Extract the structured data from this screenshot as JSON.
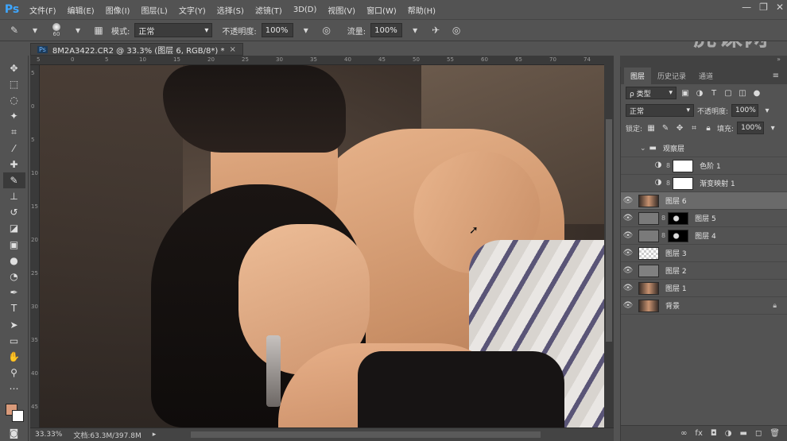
{
  "app": {
    "logo": "Ps",
    "watermark": "虎课网"
  },
  "menu": [
    "文件(F)",
    "编辑(E)",
    "图像(I)",
    "图层(L)",
    "文字(Y)",
    "选择(S)",
    "滤镜(T)",
    "3D(D)",
    "视图(V)",
    "窗口(W)",
    "帮助(H)"
  ],
  "window_controls": {
    "minimize": "—",
    "restore": "❐",
    "close": "✕"
  },
  "options_bar": {
    "brush_size": "60",
    "mode_label": "模式:",
    "mode_value": "正常",
    "opacity_label": "不透明度:",
    "opacity_value": "100%",
    "flow_label": "流量:",
    "flow_value": "100%"
  },
  "document": {
    "tab_title": "8M2A3422.CR2 @ 33.3% (图层 6, RGB/8*) *",
    "close": "×",
    "zoom": "33.33%",
    "doc_size": "文档:63.3M/397.8M"
  },
  "ruler_h_ticks": [
    "5",
    "0",
    "5",
    "10",
    "15",
    "20",
    "25",
    "30",
    "35",
    "40",
    "45",
    "50",
    "55",
    "60",
    "65",
    "70",
    "74"
  ],
  "ruler_v_ticks": [
    "5",
    "0",
    "5",
    "10",
    "15",
    "20",
    "25",
    "30",
    "35",
    "40",
    "45"
  ],
  "panel": {
    "tabs": [
      "图层",
      "历史记录",
      "通道"
    ],
    "active_tab": "图层",
    "filter_kind": "ρ 类型",
    "blend_mode": "正常",
    "opacity_label": "不透明度:",
    "opacity_value": "100%",
    "lock_label": "锁定:",
    "fill_label": "填充:",
    "fill_value": "100%"
  },
  "layers": [
    {
      "name": "观察层",
      "kind": "group",
      "visible": false
    },
    {
      "name": "色阶 1",
      "kind": "adjustment",
      "visible": false
    },
    {
      "name": "渐变映射 1",
      "kind": "adjustment",
      "visible": false
    },
    {
      "name": "图层 6",
      "kind": "photo",
      "visible": true,
      "selected": true
    },
    {
      "name": "图层 5",
      "kind": "masked",
      "visible": true
    },
    {
      "name": "图层 4",
      "kind": "masked",
      "visible": true
    },
    {
      "name": "图层 3",
      "kind": "transparent",
      "visible": true
    },
    {
      "name": "图层 2",
      "kind": "gray",
      "visible": true
    },
    {
      "name": "图层 1",
      "kind": "photo",
      "visible": true
    },
    {
      "name": "背景",
      "kind": "background",
      "visible": true,
      "locked": true
    }
  ],
  "colors": {
    "foreground": "#d99a7a",
    "background": "#ffffff",
    "ui_bg": "#535353",
    "selected_layer": "#6a6a6a"
  }
}
